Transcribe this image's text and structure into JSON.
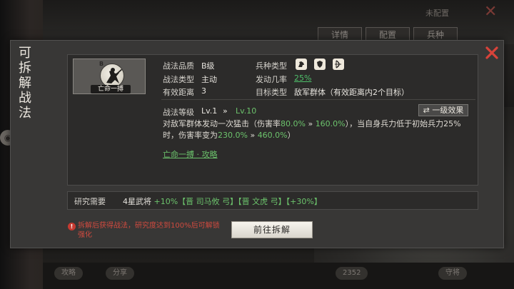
{
  "background": {
    "tabs": [
      "详情",
      "配置",
      "兵种"
    ],
    "top_right": "未配置",
    "bottom_left_1": "攻略",
    "bottom_left_2": "分享",
    "bottom_count": "2352",
    "bottom_right": "守将"
  },
  "panel": {
    "side_title": "可拆解战法",
    "close_label": "关闭"
  },
  "skill": {
    "grade_badge": "B",
    "name": "亡命一搏"
  },
  "info": {
    "quality_label": "战法品质",
    "quality_value": "B级",
    "troop_label": "兵种类型",
    "type_label": "战法类型",
    "type_value": "主动",
    "rate_label": "发动几率",
    "rate_value": "25%",
    "range_label": "有效距离",
    "range_value": "3",
    "target_label": "目标类型",
    "target_value": "敌军群体（有效距离内2个目标）",
    "troop_icons": [
      "cavalry-icon",
      "shield-icon",
      "bow-icon"
    ]
  },
  "level": {
    "label": "战法等级",
    "current": "Lv.1",
    "arrow": "»",
    "max": "Lv.10",
    "button_icon": "⇄",
    "button_label": "一级效果"
  },
  "description": {
    "p1": "对敌军群体发动一次猛击（伤害率",
    "v1": "80.0%",
    "arrow1": " » ",
    "v2": "160.0%",
    "p2": "），当自身兵力低于初始兵力25%时，伤害率变为",
    "v3": "230.0%",
    "arrow2": " » ",
    "v4": "460.0%",
    "p3": "）"
  },
  "strategy_link": "亡命一搏 · 攻略",
  "research": {
    "label": "研究需要",
    "base": "4星武将",
    "bonus": "+10%【晋 司马攸 弓】【晋 文虎 弓】【+30%】"
  },
  "warning": {
    "icon": "!",
    "text": "拆解后获得战法，研究度达到100%后可解锁强化"
  },
  "action_button": "前往拆解",
  "colors": {
    "accent_green": "#6cc36c",
    "warning_red": "#d04a3f",
    "close_red": "#d8433a"
  }
}
